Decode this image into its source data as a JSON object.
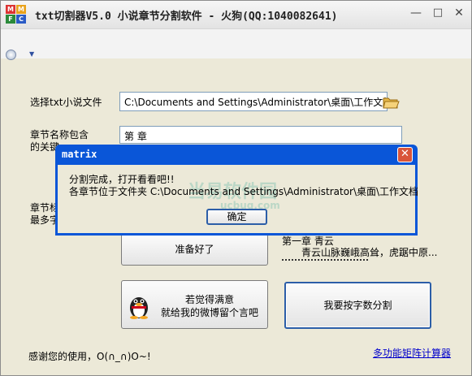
{
  "window": {
    "title": "txt切割器V5.0 小说章节分割软件 - 火狗(QQ:1040082641)",
    "minimize": "—",
    "maximize": "□",
    "close": "✕"
  },
  "form": {
    "file_label": "选择txt小说文件",
    "file_value": "C:\\Documents and Settings\\Administrator\\桌面\\工作文档.",
    "chapter_label_line1": "章节名称包含",
    "chapter_label_line2": "的关键",
    "chapter_value": "第 章",
    "maxwords_label_line1": "章节标",
    "maxwords_label_line2": "最多字"
  },
  "buttons": {
    "ready": "准备好了",
    "feedback_line1": "若觉得满意",
    "feedback_line2": "就给我的微博留个言吧",
    "split_by_count": "我要按字数分割"
  },
  "preview": {
    "heading": "第一章  青云",
    "text": "青云山脉巍峨高耸，虎踞中原..."
  },
  "footer": {
    "thanks": "感谢您的使用，O(∩_∩)O~!",
    "matrix_link": "多功能矩阵计算器"
  },
  "dialog": {
    "title": "matrix",
    "line1": "分割完成，打开看看吧!!",
    "line2": "各章节位于文件夹 C:\\Documents and Settings\\Administrator\\桌面\\工作文档",
    "ok": "确定",
    "close": "✕"
  },
  "watermark": {
    "brand": "当易软件园",
    "url": "ucbug.com"
  },
  "colors": {
    "dialog_title_bar": "#0a56d8",
    "link": "#0000cc",
    "focus_border": "#2c5ea8"
  }
}
